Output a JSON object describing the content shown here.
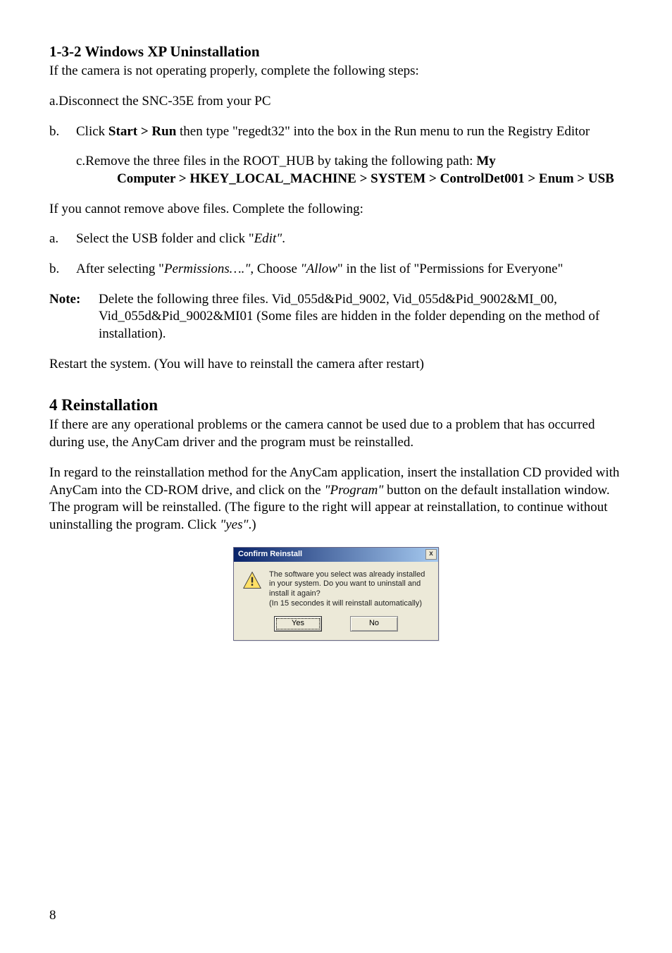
{
  "section132": {
    "heading": "1-3-2 Windows XP Uninstallation",
    "intro": "If the camera is not operating properly, complete the following steps:",
    "a_marker_prefix": "a.",
    "a_text": "Disconnect the SNC-35E from your PC",
    "b_marker": "b.",
    "b_prefix": "Click ",
    "b_bold1": "Start > Run",
    "b_suffix": " then type \"regedt32\" into the box in the Run menu to run the Registry Editor",
    "c_marker_prefix": "c.",
    "c_prefix": "Remove the three files in the ROOT_HUB by taking the following path: ",
    "c_bold": "My Computer > HKEY_LOCAL_MACHINE > SYSTEM > ControlDet001 > Enum > USB",
    "cannot": "If you cannot remove above files. Complete the following:",
    "s_a_marker": "a.",
    "s_a_prefix": "Select the USB folder and click \"",
    "s_a_italic": "Edit\"",
    "s_a_suffix": ".",
    "s_b_marker": "b.",
    "s_b_prefix": "After selecting \"",
    "s_b_italic1": "Permissions….\"",
    "s_b_mid": ", Choose ",
    "s_b_italic2": "\"Allow",
    "s_b_suffix": "\" in the list of \"Permissions for Everyone\"",
    "note_label": "Note:",
    "note_text": "Delete the following three files. Vid_055d&Pid_9002, Vid_055d&Pid_9002&MI_00, Vid_055d&Pid_9002&MI01 (Some files are hidden in the folder depending on the method of installation).",
    "restart": "Restart the system. (You will have to reinstall the camera after restart)"
  },
  "section4": {
    "heading": "4 Reinstallation",
    "p1": "If there are any operational problems or the camera cannot be used due to a problem that has occurred during use, the AnyCam driver and the program must be reinstalled.",
    "p2_a": "In regard to the reinstallation method for the AnyCam application, insert the installation CD provided with AnyCam into the CD-ROM drive, and click on the ",
    "p2_i1": "\"Program\"",
    "p2_b": " button on the default installation window. The program will be reinstalled. (The figure to the right will appear at reinstallation, to continue without uninstalling the program. Click ",
    "p2_i2": "\"yes\"",
    "p2_c": ".)"
  },
  "dialog": {
    "title": "Confirm Reinstall",
    "close": "x",
    "text": "The software you select was already installed in your system.   Do you want to uninstall and install it again?\n(In 15 secondes it will reinstall automatically)",
    "yes": "Yes",
    "no": "No"
  },
  "page_number": "8"
}
